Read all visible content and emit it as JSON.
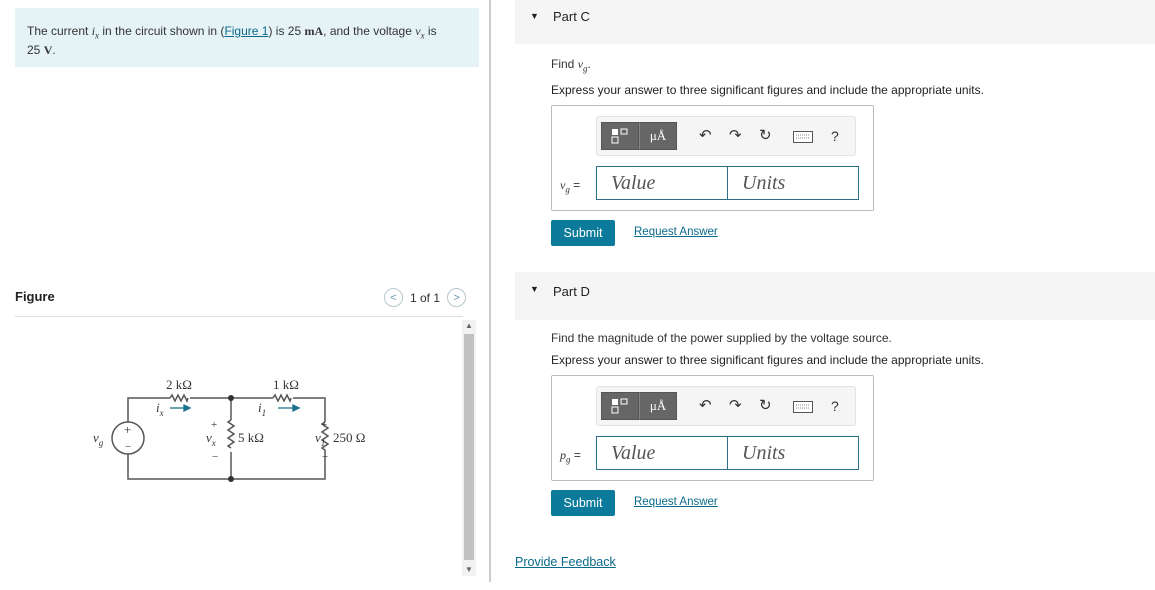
{
  "problem": {
    "text_1": "The current ",
    "sym_current": "i",
    "sub_current": "x",
    "text_2": " in the circuit shown in (",
    "figure_link": "Figure 1",
    "text_3": ") is 25 ",
    "unit_current": "mA",
    "text_4": ", and the voltage ",
    "sym_voltage": "v",
    "sub_voltage": "x",
    "text_5": " is",
    "text_6": "25 ",
    "unit_voltage": "V",
    "text_7": "."
  },
  "figure": {
    "title": "Figure",
    "pager": "1 of 1",
    "prev_glyph": "<",
    "next_glyph": ">",
    "circuit": {
      "source_label": "v",
      "source_sub": "g",
      "r1": "2 kΩ",
      "r2": "1 kΩ",
      "r3": "5 kΩ",
      "r4": "250 Ω",
      "ix_label": "i",
      "ix_sub": "x",
      "i1_label": "i",
      "i1_sub": "1",
      "vx_label": "v",
      "vx_sub": "x",
      "v1_label": "v",
      "v1_sub": "1",
      "plus": "+",
      "minus": "−"
    }
  },
  "scroll": {
    "up_glyph": "▲",
    "down_glyph": "▼"
  },
  "partC": {
    "caret": "▼",
    "label": "Part C",
    "find_prefix": "Find ",
    "find_sym": "v",
    "find_sub": "g",
    "find_suffix": ".",
    "instruction": "Express your answer to three significant figures and include the appropriate units.",
    "answer_label_sym": "v",
    "answer_label_sub": "g",
    "answer_label_eq": " =",
    "value_placeholder": "Value",
    "units_placeholder": "Units",
    "submit": "Submit",
    "request_answer": "Request Answer"
  },
  "partD": {
    "caret": "▼",
    "label": "Part D",
    "prompt": "Find the magnitude of the power supplied by the voltage source.",
    "instruction": "Express your answer to three significant figures and include the appropriate units.",
    "answer_label_sym": "p",
    "answer_label_sub": "g",
    "answer_label_eq": " =",
    "value_placeholder": "Value",
    "units_placeholder": "Units",
    "submit": "Submit",
    "request_answer": "Request Answer"
  },
  "toolbar": {
    "units_glyph": "μÅ",
    "undo_glyph": "↶",
    "redo_glyph": "↷",
    "reset_glyph": "↻",
    "help_glyph": "?"
  },
  "feedback": "Provide Feedback",
  "colors": {
    "accent": "#0c7a9a",
    "link": "#0a6a8c",
    "problem_bg": "#e5f3f6",
    "part_header_bg": "#f5f5f5",
    "current_arrow": "#1a6e8e"
  }
}
